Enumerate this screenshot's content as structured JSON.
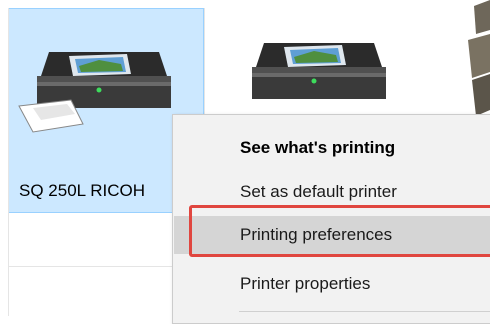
{
  "devices": {
    "selected_printer": {
      "label": "SQ 250L RICOH"
    }
  },
  "context_menu": {
    "items": [
      {
        "label": "See what's printing",
        "bold": true
      },
      {
        "label": "Set as default printer",
        "bold": false
      },
      {
        "label": "Printing preferences",
        "hovered": true,
        "highlighted": true
      },
      {
        "label": "Printer properties",
        "bold": false
      }
    ]
  },
  "colors": {
    "selection_bg": "#cce8ff",
    "selection_border": "#99d1ff",
    "menu_bg": "#f2f2f2",
    "menu_hover": "#d5d5d5",
    "highlight_border": "#e0463f"
  },
  "icons": [
    "printer-icon",
    "printer-icon",
    "device-icon"
  ]
}
